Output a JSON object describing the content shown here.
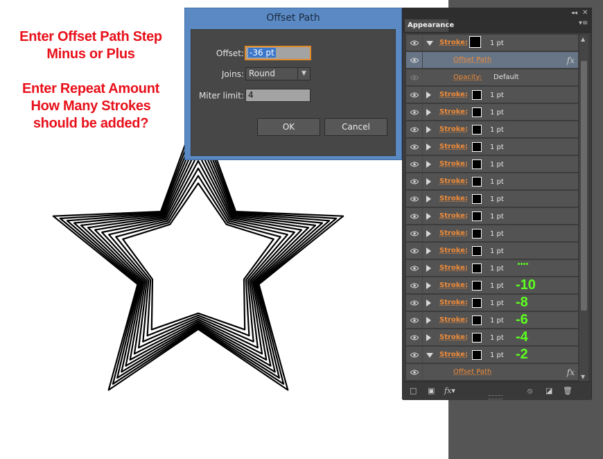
{
  "annotation": {
    "lines": [
      "Enter Offset Path Step",
      "Minus or Plus",
      "",
      "Enter Repeat Amount",
      "How Many Strokes",
      "should be added?"
    ],
    "color": "#e8101a"
  },
  "dialog": {
    "title": "Offset Path",
    "offset_label": "Offset:",
    "offset_value": "-36 pt",
    "joins_label": "Joins:",
    "joins_value": "Round",
    "miter_label": "Miter limit:",
    "miter_value": "4",
    "ok_label": "OK",
    "cancel_label": "Cancel"
  },
  "panel": {
    "tab_label": "Appearance",
    "rows": [
      {
        "type": "stroke",
        "label": "Stroke:",
        "weight": "1 pt",
        "expanded": true
      },
      {
        "type": "effect",
        "label": "Offset Path",
        "fx": "fx",
        "selected": true
      },
      {
        "type": "opacity",
        "label": "Opacity:",
        "value": "Default"
      },
      {
        "type": "stroke",
        "label": "Stroke:",
        "weight": "1 pt"
      },
      {
        "type": "stroke",
        "label": "Stroke:",
        "weight": "1 pt"
      },
      {
        "type": "stroke",
        "label": "Stroke:",
        "weight": "1 pt"
      },
      {
        "type": "stroke",
        "label": "Stroke:",
        "weight": "1 pt"
      },
      {
        "type": "stroke",
        "label": "Stroke:",
        "weight": "1 pt"
      },
      {
        "type": "stroke",
        "label": "Stroke:",
        "weight": "1 pt"
      },
      {
        "type": "stroke",
        "label": "Stroke:",
        "weight": "1 pt"
      },
      {
        "type": "stroke",
        "label": "Stroke:",
        "weight": "1 pt"
      },
      {
        "type": "stroke",
        "label": "Stroke:",
        "weight": "1 pt"
      },
      {
        "type": "stroke",
        "label": "Stroke:",
        "weight": "1 pt"
      },
      {
        "type": "stroke",
        "label": "Stroke:",
        "weight": "1 pt",
        "note": "....",
        "note_style": "dots"
      },
      {
        "type": "stroke",
        "label": "Stroke:",
        "weight": "1 pt",
        "note": "-10"
      },
      {
        "type": "stroke",
        "label": "Stroke:",
        "weight": "1 pt",
        "note": "-8"
      },
      {
        "type": "stroke",
        "label": "Stroke:",
        "weight": "1 pt",
        "note": "-6"
      },
      {
        "type": "stroke",
        "label": "Stroke:",
        "weight": "1 pt",
        "note": "-4"
      },
      {
        "type": "stroke",
        "label": "Stroke:",
        "weight": "1 pt",
        "note": "-2",
        "expanded": true
      },
      {
        "type": "effect",
        "label": "Offset Path",
        "fx": "fx"
      }
    ],
    "note_color": "#5cff1f",
    "label_color": "#f08c3a",
    "footer_icons": [
      "new-stroke-icon",
      "new-fill-icon",
      "fx-menu-icon",
      "clear-appearance-icon",
      "duplicate-item-icon",
      "delete-item-icon"
    ]
  },
  "artwork": {
    "object": "star",
    "stroke_count": 11,
    "stroke_color": "#000000"
  }
}
